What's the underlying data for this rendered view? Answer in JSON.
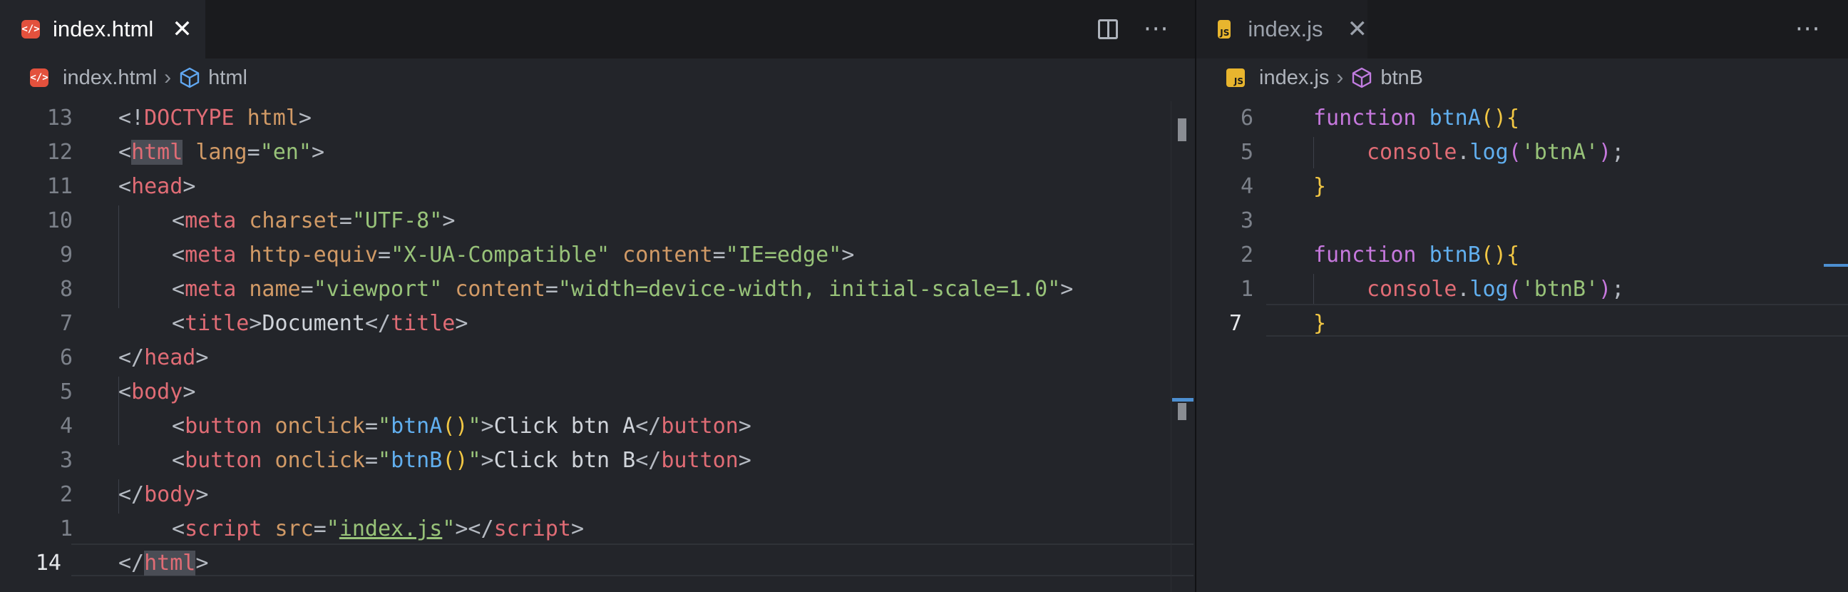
{
  "left_editor": {
    "tab": {
      "label": "index.html",
      "close": "✕"
    },
    "actions": {
      "more": "···"
    },
    "breadcrumb": {
      "file": "index.html",
      "symbol": "html"
    },
    "lines": [
      {
        "num": "13"
      },
      {
        "num": "12"
      },
      {
        "num": "11"
      },
      {
        "num": "10"
      },
      {
        "num": "9"
      },
      {
        "num": "8"
      },
      {
        "num": "7"
      },
      {
        "num": "6"
      },
      {
        "num": "5"
      },
      {
        "num": "4"
      },
      {
        "num": "3"
      },
      {
        "num": "2"
      },
      {
        "num": "1"
      },
      {
        "num": "14"
      }
    ],
    "code": {
      "l1": {
        "a": "<!",
        "b": "DOCTYPE",
        "c": " html",
        "d": ">"
      },
      "l2": {
        "a": "<",
        "b": "html",
        "c": " lang",
        "d": "=",
        "e": "\"en\"",
        "f": ">"
      },
      "l3": {
        "a": "<",
        "b": "head",
        "c": ">"
      },
      "l4": {
        "a": "<",
        "b": "meta",
        "c": " charset",
        "d": "=",
        "e": "\"UTF-8\"",
        "f": ">"
      },
      "l5": {
        "a": "<",
        "b": "meta",
        "c": " http-equiv",
        "d": "=",
        "e": "\"X-UA-Compatible\"",
        "f": " content",
        "g": "=",
        "h": "\"IE=edge\"",
        "i": ">"
      },
      "l6": {
        "a": "<",
        "b": "meta",
        "c": " name",
        "d": "=",
        "e": "\"viewport\"",
        "f": " content",
        "g": "=",
        "h": "\"width=device-width, initial-scale=1.0\"",
        "i": ">"
      },
      "l7": {
        "a": "<",
        "b": "title",
        "c": ">",
        "d": "Document",
        "e": "</",
        "f": "title",
        "g": ">"
      },
      "l8": {
        "a": "</",
        "b": "head",
        "c": ">"
      },
      "l9": {
        "a": "<",
        "b": "body",
        "c": ">"
      },
      "l10": {
        "a": "<",
        "b": "button",
        "c": " onclick",
        "d": "=",
        "e": "\"",
        "f": "btnA",
        "g": "()",
        "h": "\"",
        "i": ">",
        "j": "Click btn A",
        "k": "</",
        "l": "button",
        "m": ">"
      },
      "l11": {
        "a": "<",
        "b": "button",
        "c": " onclick",
        "d": "=",
        "e": "\"",
        "f": "btnB",
        "g": "()",
        "h": "\"",
        "i": ">",
        "j": "Click btn B",
        "k": "</",
        "l": "button",
        "m": ">"
      },
      "l12": {
        "a": "</",
        "b": "body",
        "c": ">"
      },
      "l13": {
        "a": "<",
        "b": "script",
        "c": " src",
        "d": "=",
        "e": "\"",
        "f": "index.js",
        "g": "\"",
        "h": "></",
        "i": "script",
        "j": ">"
      },
      "l14": {
        "a": "</",
        "b": "html",
        "c": ">"
      }
    }
  },
  "right_editor": {
    "tab": {
      "label": "index.js",
      "close": "✕"
    },
    "actions": {
      "more": "···"
    },
    "breadcrumb": {
      "file": "index.js",
      "symbol": "btnB"
    },
    "lines": [
      {
        "num": "6"
      },
      {
        "num": "5"
      },
      {
        "num": "4"
      },
      {
        "num": "3"
      },
      {
        "num": "2"
      },
      {
        "num": "1"
      },
      {
        "num": "7"
      }
    ],
    "code": {
      "l1": {
        "a": "function",
        "b": " ",
        "c": "btnA",
        "d": "()",
        "e": "{"
      },
      "l2": {
        "a": "console",
        "b": ".",
        "c": "log",
        "d": "(",
        "e": "'btnA'",
        "f": ")",
        "g": ";"
      },
      "l3": {
        "a": "}"
      },
      "l5": {
        "a": "function",
        "b": " ",
        "c": "btnB",
        "d": "()",
        "e": "{"
      },
      "l6": {
        "a": "console",
        "b": ".",
        "c": "log",
        "d": "(",
        "e": "'btnB'",
        "f": ")",
        "g": ";"
      },
      "l7": {
        "a": "}"
      }
    }
  },
  "colors": {
    "background": "#23252a",
    "tag": "#e06c75",
    "attribute": "#d19a66",
    "string": "#98c379",
    "keyword": "#c678dd",
    "function": "#61afef",
    "bracket": "#f2c744"
  },
  "icons": [
    "html-file-icon",
    "js-file-icon",
    "split-editor-icon",
    "more-actions-icon",
    "close-icon",
    "chevron-right-icon",
    "symbol-cube-icon"
  ]
}
